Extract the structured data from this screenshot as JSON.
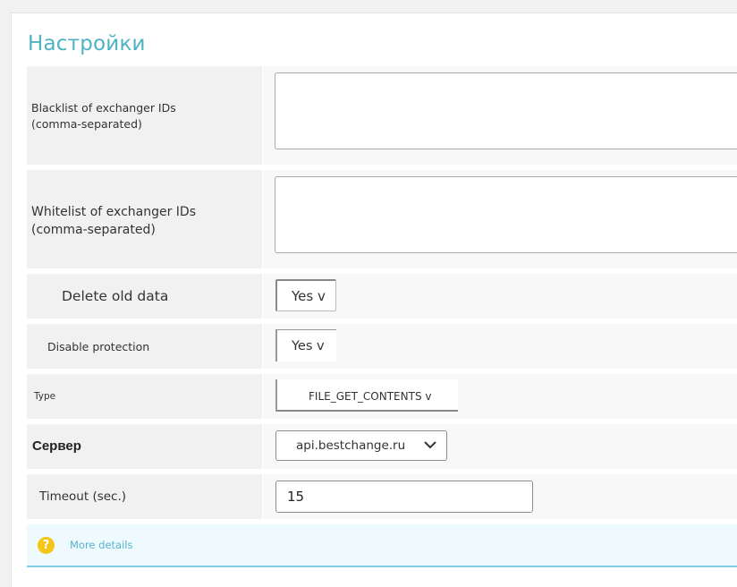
{
  "page": {
    "title": "Настройки"
  },
  "fields": {
    "blacklist": {
      "label": "Blacklist of exchanger IDs (comma-separated)",
      "value": ""
    },
    "whitelist": {
      "label": "Whitelist of exchanger IDs (comma-separated)",
      "value": ""
    },
    "delete_old_data": {
      "label": "Delete old data",
      "value": "Yes v"
    },
    "disable_protection": {
      "label": "Disable protection",
      "value": "Yes v"
    },
    "type": {
      "label": "Type",
      "value": "FILE_GET_CONTENTS v"
    },
    "server": {
      "label": "Сервер",
      "value": "api.bestchange.ru"
    },
    "timeout": {
      "label": "Timeout (sec.)",
      "value": "15"
    }
  },
  "note": {
    "link": "More details",
    "icon": "question-circle-icon"
  },
  "colors": {
    "title": "#4cb3c4",
    "note_bg": "#eefafd",
    "note_border": "#7fd0e6",
    "icon": "#f5c518"
  }
}
